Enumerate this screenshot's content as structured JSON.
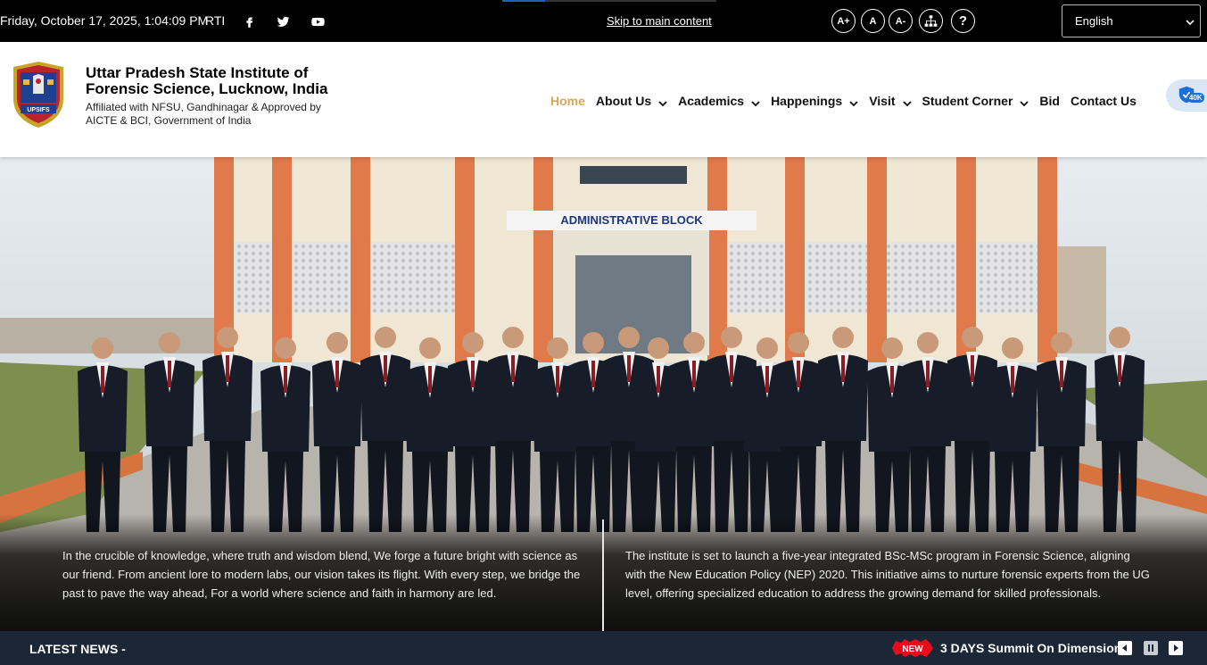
{
  "topbar": {
    "datetime": "Friday, October 17, 2025, 1:04:09 PM",
    "rti": "RTI",
    "social": [
      "facebook-icon",
      "twitter-icon",
      "youtube-icon"
    ],
    "skip_link": "Skip to main content",
    "accessibility": {
      "increase": "A+",
      "normal": "A",
      "decrease": "A-",
      "sitemap_icon": "sitemap-icon",
      "help": "?"
    },
    "language": "English"
  },
  "header": {
    "title": "Uttar Pradesh State Institute of Forensic Science, Lucknow, India",
    "subtitle": "Affiliated with NFSU, Gandhinagar & Approved by AICTE & BCI, Government of India",
    "logo_text": "UPSIFS",
    "floater_badge": "40K"
  },
  "nav": [
    {
      "label": "Home",
      "active": true,
      "dropdown": false
    },
    {
      "label": "About Us",
      "active": false,
      "dropdown": true
    },
    {
      "label": "Academics",
      "active": false,
      "dropdown": true
    },
    {
      "label": "Happenings",
      "active": false,
      "dropdown": true
    },
    {
      "label": "Visit",
      "active": false,
      "dropdown": true
    },
    {
      "label": "Student Corner",
      "active": false,
      "dropdown": true
    },
    {
      "label": "Bid",
      "active": false,
      "dropdown": false
    },
    {
      "label": "Contact Us",
      "active": false,
      "dropdown": false
    }
  ],
  "hero": {
    "building_sign": "ADMINISTRATIVE BLOCK",
    "caption_left": "In the crucible of  knowledge, where truth and wisdom blend, We forge a future bright with science as our friend. From ancient lore to modern labs, our vision takes its flight. With every step, we bridge the past to pave the way ahead, For a world where science and faith in harmony are led.",
    "caption_right": "The institute is set to launch a five-year integrated BSc-MSc program in Forensic Science, aligning with the New Education Policy (NEP) 2020. This initiative aims to nurture forensic experts from the UG level, offering specialized education to address the growing demand for skilled professionals."
  },
  "news": {
    "label": "LATEST NEWS -",
    "badge": "NEW",
    "headline": "3 DAYS Summit On Dimension"
  },
  "colors": {
    "topbar_bg": "#000000",
    "nav_active": "#d9a655",
    "newsbar_bg": "#1b2637",
    "building_orange": "#e07a4a"
  }
}
